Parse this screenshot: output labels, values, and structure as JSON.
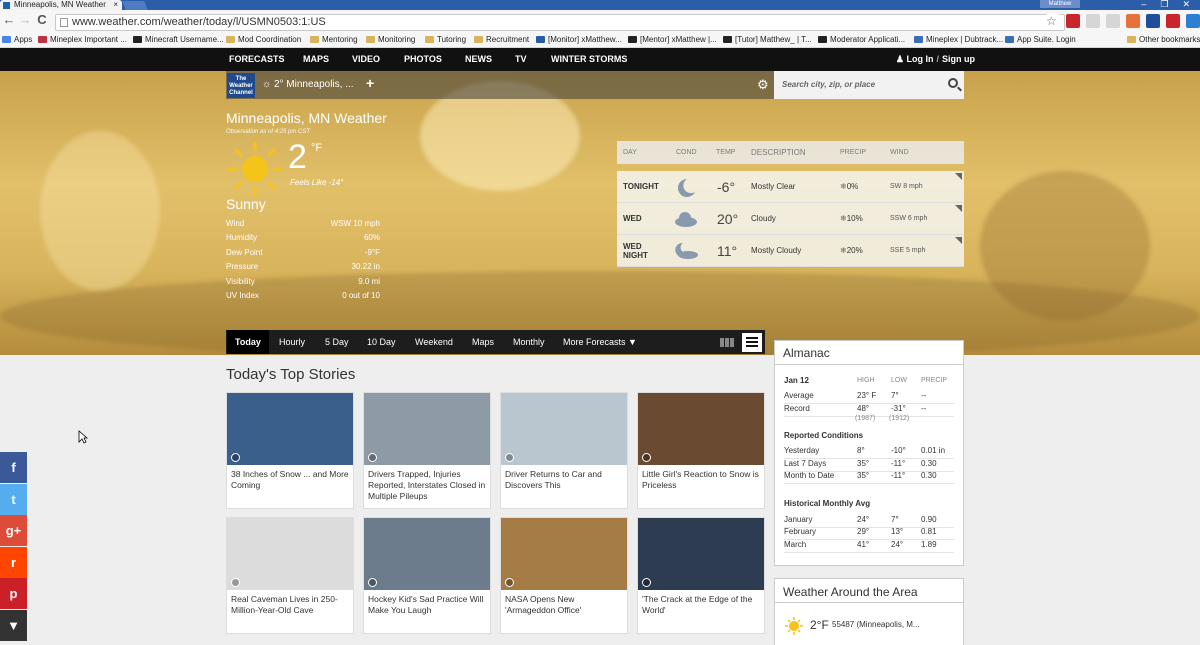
{
  "browser": {
    "tab_title": "Minneapolis, MN Weather",
    "tab_close": "×",
    "profile": "Matthew",
    "window_controls": [
      "–",
      "❐",
      "✕"
    ],
    "url": "www.weather.com/weather/today/l/USMN0503:1:US",
    "nav": {
      "back": "←",
      "forward": "→",
      "reload": "C"
    },
    "extensions": [
      {
        "name": "star-icon",
        "color": "#ffffff"
      },
      {
        "name": "adblock-icon",
        "color": "#c8252c"
      },
      {
        "name": "a-icon",
        "color": "#d6d6d6"
      },
      {
        "name": "cast-icon",
        "color": "#d6d6d6"
      },
      {
        "name": "ring-icon",
        "color": "#e8703a"
      },
      {
        "name": "extension-icon",
        "color": "#1f4f9a"
      },
      {
        "name": "cross-icon",
        "color": "#c8252c"
      },
      {
        "name": "download-icon",
        "color": "#2c7fd1"
      },
      {
        "name": "menu-icon",
        "color": "#bbbbbb"
      }
    ],
    "bookmarks": [
      "Apps",
      "Mineplex Important ...",
      "Minecraft Username...",
      "Mod Coordination",
      "Mentoring",
      "Monitoring",
      "Tutoring",
      "Recruitment",
      "[Monitor] xMatthew...",
      "[Mentor] xMatthew |...",
      "[Tutor] Matthew_ | T...",
      "Moderator Applicati...",
      "Mineplex | Dubtrack...",
      "App Suite. Login",
      "Other bookmarks"
    ]
  },
  "site_nav": {
    "links": [
      "FORECASTS",
      "MAPS",
      "VIDEO",
      "PHOTOS",
      "NEWS",
      "TV",
      "WINTER STORMS"
    ],
    "login": "Log In",
    "signup": "Sign up",
    "separator": "/"
  },
  "location_bar": {
    "logo": "The Weather Channel",
    "saved_location": "2° Minneapolis, ...",
    "add": "+",
    "search_placeholder": "Search city, zip, or place"
  },
  "current": {
    "title": "Minneapolis, MN Weather",
    "observed": "Observation as of 4:25 pm CST",
    "temp": "2",
    "unit": "°F",
    "feels_like": "Feels Like -14°",
    "condition": "Sunny",
    "details": [
      {
        "label": "Wind",
        "value": "WSW 10 mph"
      },
      {
        "label": "Humidity",
        "value": "60%"
      },
      {
        "label": "Dew Point",
        "value": "-9°F"
      },
      {
        "label": "Pressure",
        "value": "30.22 in"
      },
      {
        "label": "Visibility",
        "value": "9.0 mi"
      },
      {
        "label": "UV Index",
        "value": "0 out of 10"
      }
    ]
  },
  "forecast_table": {
    "headers": [
      "DAY",
      "COND",
      "TEMP",
      "DESCRIPTION",
      "PRECIP",
      "WIND"
    ],
    "rows": [
      {
        "day": "TONIGHT",
        "icon": "moon-icon",
        "temp": "-6°",
        "desc": "Mostly Clear",
        "precip": "0%",
        "wind": "SW 8 mph"
      },
      {
        "day": "WED",
        "icon": "cloud-icon",
        "temp": "20°",
        "desc": "Cloudy",
        "precip": "10%",
        "wind": "SSW 6 mph"
      },
      {
        "day": "WED NIGHT",
        "icon": "partly-cloudy-night-icon",
        "temp": "11°",
        "desc": "Mostly Cloudy",
        "precip": "20%",
        "wind": "SSE 5 mph"
      }
    ]
  },
  "forecast_tabs": [
    "Today",
    "Hourly",
    "5 Day",
    "10 Day",
    "Weekend",
    "Maps",
    "Monthly",
    "More Forecasts"
  ],
  "stories": {
    "title": "Today's Top Stories",
    "items": [
      {
        "caption": "38 Inches of Snow ... and More Coming",
        "media": "video",
        "img_color": "#3a5f8a"
      },
      {
        "caption": "Drivers Trapped, Injuries Reported, Interstates Closed in Multiple Pileups",
        "media": "video",
        "img_color": "#8e9aa6"
      },
      {
        "caption": "Driver Returns to Car and Discovers This",
        "media": "video",
        "img_color": "#b9c6cf"
      },
      {
        "caption": "Little Girl's Reaction to Snow is Priceless",
        "media": "video",
        "img_color": "#6b4a32"
      },
      {
        "caption": "Real Caveman Lives in 250-Million-Year-Old Cave",
        "media": "video",
        "img_color": "#dcdcdc"
      },
      {
        "caption": "Hockey Kid's Sad Practice Will Make You Laugh",
        "media": "video",
        "img_color": "#6d7c8d"
      },
      {
        "caption": "NASA Opens New 'Armageddon Office'",
        "media": "video",
        "img_color": "#a57c45"
      },
      {
        "caption": "'The Crack at the Edge of the World'",
        "media": "photo",
        "img_color": "#2e3c52"
      }
    ]
  },
  "almanac": {
    "title": "Almanac",
    "date": "Jan 12",
    "headers": [
      "HIGH",
      "LOW",
      "PRECIP"
    ],
    "rows": [
      {
        "label": "Average",
        "high": "23° F",
        "low": "7°",
        "precip": "--"
      },
      {
        "label": "Record",
        "high": "48°",
        "low": "-31°",
        "precip": "--",
        "high_year": "(1987)",
        "low_year": "(1912)"
      }
    ],
    "reported_title": "Reported Conditions",
    "reported": [
      {
        "label": "Yesterday",
        "high": "8°",
        "low": "-10°",
        "precip": "0.01 in"
      },
      {
        "label": "Last 7 Days",
        "high": "35°",
        "low": "-11°",
        "precip": "0.30"
      },
      {
        "label": "Month to Date",
        "high": "35°",
        "low": "-11°",
        "precip": "0.30"
      }
    ],
    "historical_title": "Historical Monthly Avg",
    "historical": [
      {
        "label": "January",
        "high": "24°",
        "low": "7°",
        "precip": "0.90"
      },
      {
        "label": "February",
        "high": "29°",
        "low": "13°",
        "precip": "0.81"
      },
      {
        "label": "March",
        "high": "41°",
        "low": "24°",
        "precip": "1.89"
      }
    ]
  },
  "around": {
    "title": "Weather Around the Area",
    "temp": "2°F",
    "place": "55487 (Minneapolis, M..."
  },
  "social": [
    {
      "name": "facebook-icon",
      "label": "f",
      "color": "#3b5998"
    },
    {
      "name": "twitter-icon",
      "label": "t",
      "color": "#55acee"
    },
    {
      "name": "googleplus-icon",
      "label": "g+",
      "color": "#dd4b39"
    },
    {
      "name": "reddit-icon",
      "label": "r",
      "color": "#ff4500"
    },
    {
      "name": "pinterest-icon",
      "label": "p",
      "color": "#cb2027"
    },
    {
      "name": "more-icon",
      "label": "▼",
      "color": "#333333"
    }
  ],
  "colors": {
    "accent": "#1f4b8e",
    "nav_bg": "#111111",
    "hero": "#d8b45c"
  }
}
